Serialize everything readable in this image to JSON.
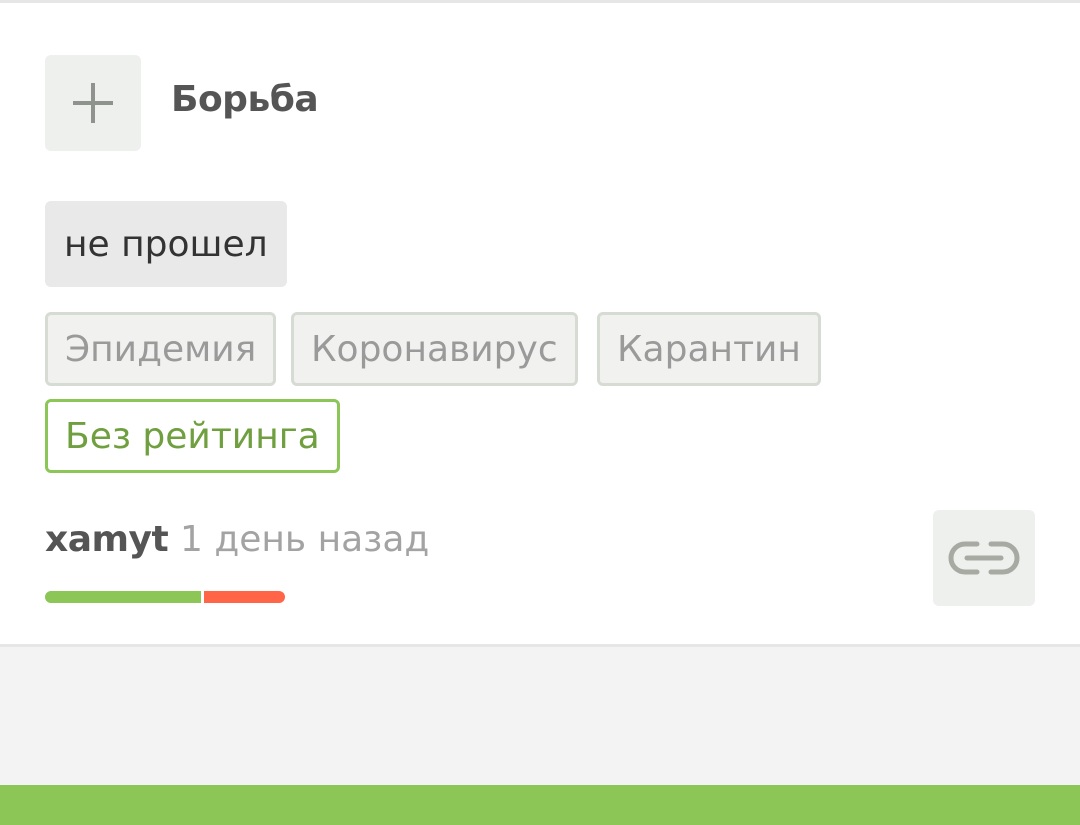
{
  "community": {
    "name": "Борьба",
    "add_icon": "plus-icon"
  },
  "post": {
    "title": "не прошел",
    "tags": [
      "Эпидемия",
      "Коронавирус",
      "Карантин"
    ],
    "special_tag": "Без рейтинга",
    "author": "xamyt",
    "time": "1 день назад",
    "rating": {
      "positive_fraction": 0.65,
      "positive_color": "#8bc657",
      "negative_color": "#ff6546"
    },
    "link_icon": "link-icon"
  },
  "colors": {
    "accent": "#8bc657"
  }
}
